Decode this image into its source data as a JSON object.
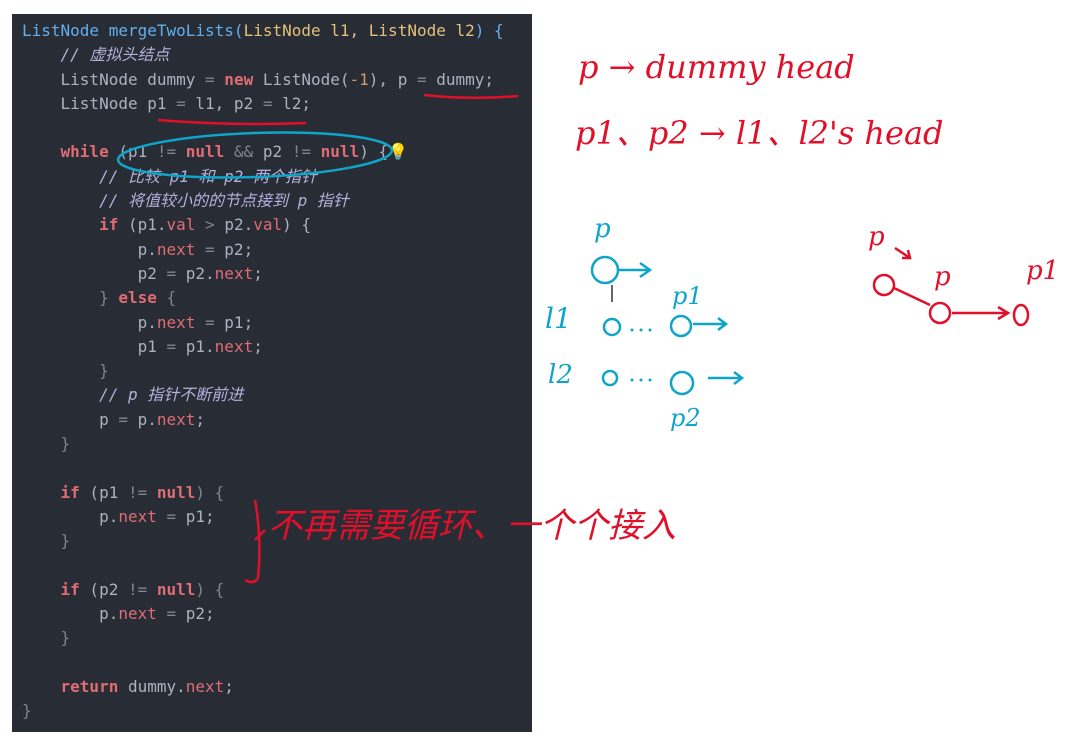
{
  "code": {
    "lines": [
      [
        {
          "t": "ListNode mergeTwoLists(",
          "c": "ty"
        },
        {
          "t": "ListNode l1, ListNode l2",
          "c": "fn"
        },
        {
          "t": ") {",
          "c": "ty"
        }
      ],
      [
        {
          "t": "    // 虚拟头结点",
          "c": "cm"
        }
      ],
      [
        {
          "t": "    ListNode dummy ",
          "c": ""
        },
        {
          "t": "=",
          "c": "punc"
        },
        {
          "t": " new",
          "c": "kw"
        },
        {
          "t": " ListNode(",
          "c": ""
        },
        {
          "t": "-1",
          "c": "num"
        },
        {
          "t": "), p ",
          "c": ""
        },
        {
          "t": "=",
          "c": "punc"
        },
        {
          "t": " dummy;",
          "c": ""
        }
      ],
      [
        {
          "t": "    ListNode p1 ",
          "c": ""
        },
        {
          "t": "=",
          "c": "punc"
        },
        {
          "t": " l1, p2 ",
          "c": ""
        },
        {
          "t": "=",
          "c": "punc"
        },
        {
          "t": " l2;",
          "c": ""
        }
      ],
      [
        {
          "t": "",
          "c": ""
        }
      ],
      [
        {
          "t": "    while",
          "c": "kw"
        },
        {
          "t": " (p1 ",
          "c": ""
        },
        {
          "t": "!=",
          "c": "punc"
        },
        {
          "t": " null",
          "c": "kw"
        },
        {
          "t": " ",
          "c": ""
        },
        {
          "t": "&&",
          "c": "punc"
        },
        {
          "t": " p2 ",
          "c": ""
        },
        {
          "t": "!=",
          "c": "punc"
        },
        {
          "t": " null",
          "c": "kw"
        },
        {
          "t": ") {",
          "c": ""
        },
        {
          "t": "💡",
          "c": "bulb"
        }
      ],
      [
        {
          "t": "        // 比较 p1 和 p2 两个指针",
          "c": "cm"
        }
      ],
      [
        {
          "t": "        // 将值较小的的节点接到 p 指针",
          "c": "cm"
        }
      ],
      [
        {
          "t": "        if",
          "c": "kw"
        },
        {
          "t": " (p1.",
          "c": ""
        },
        {
          "t": "val",
          "c": "prop"
        },
        {
          "t": " > ",
          "c": "punc"
        },
        {
          "t": "p2.",
          "c": ""
        },
        {
          "t": "val",
          "c": "prop"
        },
        {
          "t": ") {",
          "c": ""
        }
      ],
      [
        {
          "t": "            p.",
          "c": ""
        },
        {
          "t": "next",
          "c": "prop"
        },
        {
          "t": " = ",
          "c": "punc"
        },
        {
          "t": "p2;",
          "c": ""
        }
      ],
      [
        {
          "t": "            p2 ",
          "c": ""
        },
        {
          "t": "=",
          "c": "punc"
        },
        {
          "t": " p2.",
          "c": ""
        },
        {
          "t": "next",
          "c": "prop"
        },
        {
          "t": ";",
          "c": ""
        }
      ],
      [
        {
          "t": "        } ",
          "c": "punc"
        },
        {
          "t": "else",
          "c": "kw"
        },
        {
          "t": " {",
          "c": "punc"
        }
      ],
      [
        {
          "t": "            p.",
          "c": ""
        },
        {
          "t": "next",
          "c": "prop"
        },
        {
          "t": " = ",
          "c": "punc"
        },
        {
          "t": "p1;",
          "c": ""
        }
      ],
      [
        {
          "t": "            p1 ",
          "c": ""
        },
        {
          "t": "=",
          "c": "punc"
        },
        {
          "t": " p1.",
          "c": ""
        },
        {
          "t": "next",
          "c": "prop"
        },
        {
          "t": ";",
          "c": ""
        }
      ],
      [
        {
          "t": "        }",
          "c": "punc"
        }
      ],
      [
        {
          "t": "        // p 指针不断前进",
          "c": "cm"
        }
      ],
      [
        {
          "t": "        p ",
          "c": ""
        },
        {
          "t": "=",
          "c": "punc"
        },
        {
          "t": " p.",
          "c": ""
        },
        {
          "t": "next",
          "c": "prop"
        },
        {
          "t": ";",
          "c": ""
        }
      ],
      [
        {
          "t": "    }",
          "c": "punc"
        }
      ],
      [
        {
          "t": "",
          "c": ""
        }
      ],
      [
        {
          "t": "    if",
          "c": "kw"
        },
        {
          "t": " (p1 ",
          "c": ""
        },
        {
          "t": "!=",
          "c": "punc"
        },
        {
          "t": " null",
          "c": "kw"
        },
        {
          "t": ") {",
          "c": "punc"
        }
      ],
      [
        {
          "t": "        p.",
          "c": ""
        },
        {
          "t": "next",
          "c": "prop"
        },
        {
          "t": " = ",
          "c": "punc"
        },
        {
          "t": "p1;",
          "c": ""
        }
      ],
      [
        {
          "t": "    }",
          "c": "punc"
        }
      ],
      [
        {
          "t": "",
          "c": ""
        }
      ],
      [
        {
          "t": "    if",
          "c": "kw"
        },
        {
          "t": " (p2 ",
          "c": ""
        },
        {
          "t": "!=",
          "c": "punc"
        },
        {
          "t": " null",
          "c": "kw"
        },
        {
          "t": ") {",
          "c": "punc"
        }
      ],
      [
        {
          "t": "        p.",
          "c": ""
        },
        {
          "t": "next",
          "c": "prop"
        },
        {
          "t": " = ",
          "c": "punc"
        },
        {
          "t": "p2;",
          "c": ""
        }
      ],
      [
        {
          "t": "    }",
          "c": "punc"
        }
      ],
      [
        {
          "t": "",
          "c": ""
        }
      ],
      [
        {
          "t": "    return",
          "c": "kw"
        },
        {
          "t": " dummy.",
          "c": ""
        },
        {
          "t": "next",
          "c": "prop"
        },
        {
          "t": ";",
          "c": ""
        }
      ],
      [
        {
          "t": "}",
          "c": "punc"
        }
      ]
    ]
  },
  "annotations": {
    "note1": "p → dummy head",
    "note2": "p1、p2 → l1、l2's head",
    "bracket_note": "不再需要循环、一个个接入",
    "blue_p": "p",
    "blue_p1": "p1",
    "blue_p2": "p2",
    "blue_l1": "l1",
    "blue_l2": "l2",
    "red_p_top": "p",
    "red_p_mid": "p",
    "red_p1": "p1"
  },
  "colors": {
    "editor_bg": "#282c34",
    "annotation_red": "#e0102a",
    "annotation_blue": "#0ea5c9"
  }
}
